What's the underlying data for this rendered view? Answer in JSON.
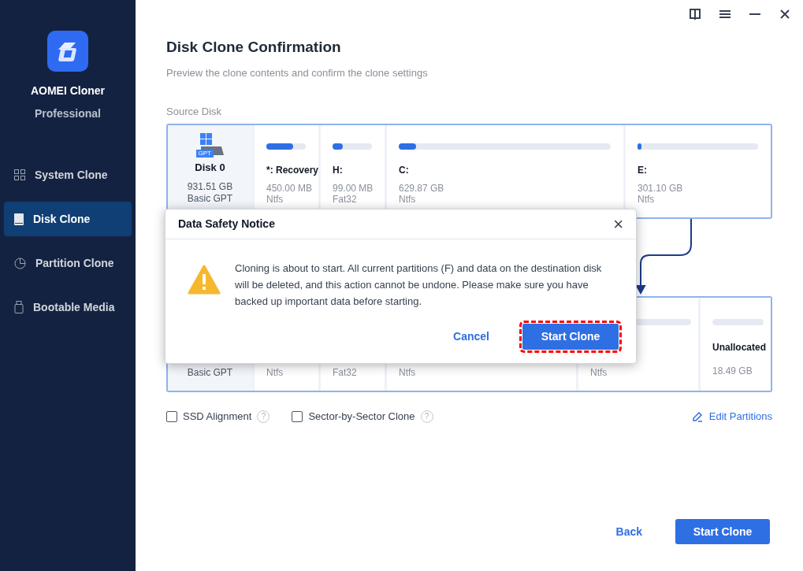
{
  "sidebar": {
    "app_name": "AOMEI Cloner",
    "edition": "Professional",
    "items": [
      {
        "label": "System Clone",
        "selected": false
      },
      {
        "label": "Disk Clone",
        "selected": true
      },
      {
        "label": "Partition Clone",
        "selected": false
      },
      {
        "label": "Bootable Media",
        "selected": false
      }
    ]
  },
  "header": {
    "title": "Disk Clone Confirmation",
    "subtitle": "Preview the clone contents and confirm the clone settings"
  },
  "source": {
    "label": "Source Disk",
    "disk": {
      "name": "Disk 0",
      "badge": "GPT",
      "size": "931.51 GB",
      "type": "Basic GPT"
    },
    "partitions": [
      {
        "name": "*: Recovery",
        "size": "450.00 MB",
        "fs": "Ntfs",
        "level": 0.68
      },
      {
        "name": "H:",
        "size": "99.00 MB",
        "fs": "Fat32",
        "level": 0.25
      },
      {
        "name": "C:",
        "size": "629.87 GB",
        "fs": "Ntfs",
        "level": 0.08
      },
      {
        "name": "E:",
        "size": "301.10 GB",
        "fs": "Ntfs",
        "level": 0.03
      }
    ]
  },
  "destination": {
    "disk": {
      "type": "Basic GPT"
    },
    "partitions": [
      {
        "kind": "plain",
        "fs": "Ntfs"
      },
      {
        "kind": "plain",
        "fs": "Fat32"
      },
      {
        "kind": "plain",
        "fs": "Ntfs"
      },
      {
        "kind": "bar",
        "fs": "Ntfs"
      },
      {
        "kind": "bar",
        "name": "Unallocated",
        "size": "18.49 GB"
      }
    ]
  },
  "options": [
    {
      "label": "SSD Alignment",
      "checked": false,
      "help": "?"
    },
    {
      "label": "Sector-by-Sector Clone",
      "checked": false,
      "help": "?"
    }
  ],
  "edit_partitions": "Edit Partitions",
  "footer": {
    "back": "Back",
    "start": "Start Clone"
  },
  "dialog": {
    "title": "Data Safety Notice",
    "close": "×",
    "message": "Cloning is about to start. All current partitions (F) and data on the destination disk will be deleted, and this action cannot be undone. Please make sure you have backed up important data before starting.",
    "cancel": "Cancel",
    "confirm": "Start Clone",
    "confirm_highlighted": true
  }
}
